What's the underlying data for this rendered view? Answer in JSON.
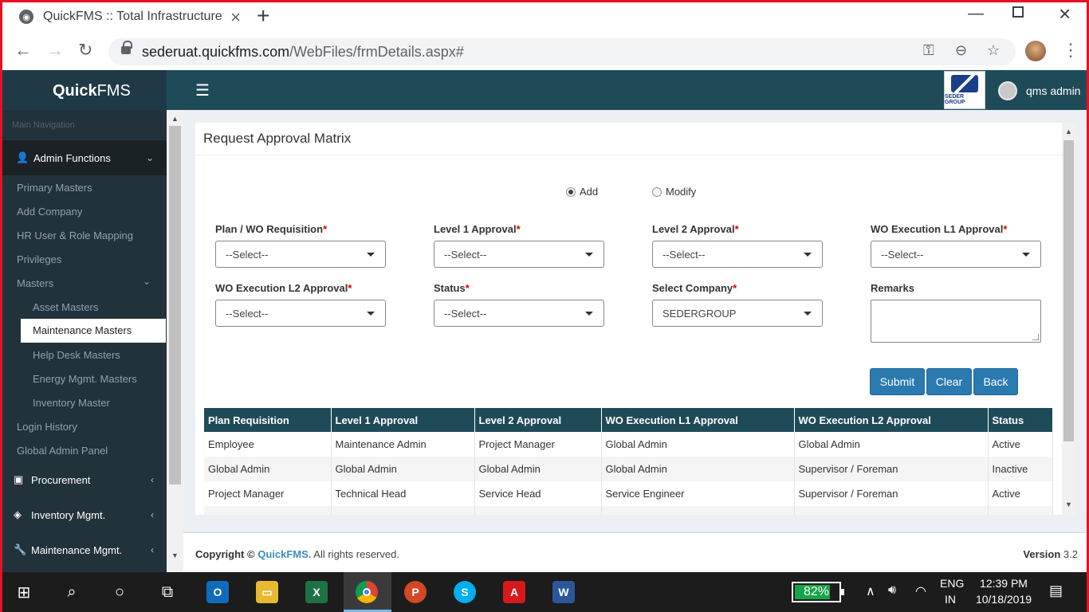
{
  "browser": {
    "tab_title": "QuickFMS :: Total Infrastructure C",
    "url_domain": "sederuat.quickfms.com",
    "url_path": "/WebFiles/frmDetails.aspx#"
  },
  "header": {
    "logo_bold": "Quick",
    "logo_rest": "FMS",
    "company_logo_text": "SEDER GROUP",
    "user_name": "qms admin"
  },
  "sidebar": {
    "heading": "Main Navigation",
    "section_admin": "Admin Functions",
    "items": [
      "Primary Masters",
      "Add Company",
      "HR User & Role Mapping",
      "Privileges",
      "Masters"
    ],
    "masters_items": [
      "Asset Masters",
      "Maintenance Masters",
      "Help Desk Masters",
      "Energy Mgmt. Masters",
      "Inventory Master"
    ],
    "after_items": [
      "Login History",
      "Global Admin Panel"
    ],
    "sections": [
      "Procurement",
      "Inventory Mgmt.",
      "Maintenance Mgmt."
    ]
  },
  "page": {
    "title": "Request Approval Matrix",
    "radio_add": "Add",
    "radio_modify": "Modify",
    "fields": {
      "plan": {
        "label": "Plan / WO Requisition",
        "value": "--Select--"
      },
      "l1": {
        "label": "Level 1 Approval",
        "value": "--Select--"
      },
      "l2": {
        "label": "Level 2 Approval",
        "value": "--Select--"
      },
      "woe1": {
        "label": "WO Execution L1 Approval",
        "value": "--Select--"
      },
      "woe2": {
        "label": "WO Execution L2 Approval",
        "value": "--Select--"
      },
      "status": {
        "label": "Status",
        "value": "--Select--"
      },
      "company": {
        "label": "Select Company",
        "value": "SEDERGROUP"
      },
      "remarks": {
        "label": "Remarks"
      }
    },
    "required_mark": "*",
    "buttons": {
      "submit": "Submit",
      "clear": "Clear",
      "back": "Back"
    },
    "table": {
      "headers": [
        "Plan Requisition",
        "Level 1 Approval",
        "Level 2 Approval",
        "WO Execution L1 Approval",
        "WO Execution L2 Approval",
        "Status"
      ],
      "rows": [
        [
          "Employee",
          "Maintenance Admin",
          "Project Manager",
          "Global Admin",
          "Global Admin",
          "Active"
        ],
        [
          "Global Admin",
          "Global Admin",
          "Global Admin",
          "Global Admin",
          "Supervisor / Foreman",
          "Inactive"
        ],
        [
          "Project Manager",
          "Technical Head",
          "Service Head",
          "Service Engineer",
          "Supervisor / Foreman",
          "Active"
        ]
      ]
    }
  },
  "footer": {
    "copyright": "Copyright ©",
    "brand": "QuickFMS.",
    "rights": "All rights reserved.",
    "version_label": "Version",
    "version": "3.2"
  },
  "taskbar": {
    "battery_percent": "82%",
    "battery_level": 0.82,
    "lang_top": "ENG",
    "lang_bottom": "IN",
    "time": "12:39 PM",
    "date": "10/18/2019",
    "apps": [
      "windows-start",
      "search",
      "cortana",
      "task-view",
      "outlook",
      "file-explorer",
      "excel",
      "chrome",
      "powerpoint",
      "skype",
      "acrobat",
      "word"
    ]
  }
}
